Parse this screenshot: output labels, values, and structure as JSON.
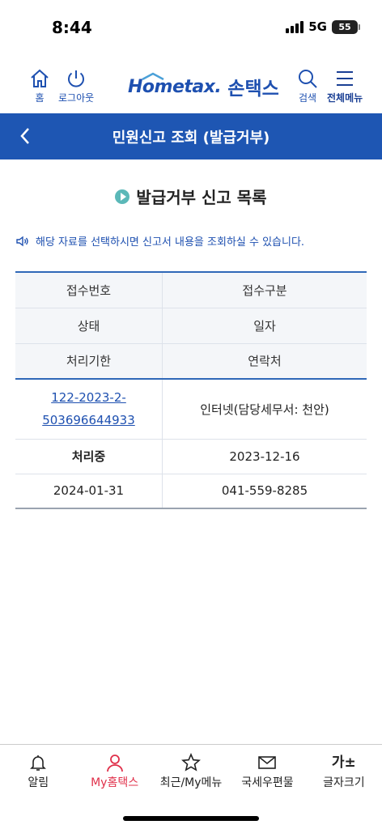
{
  "status_bar": {
    "time": "8:44",
    "network": "5G",
    "battery": "55"
  },
  "header": {
    "home_label": "홈",
    "logout_label": "로그아웃",
    "logo_text": "Hometax.",
    "logo_service": "손택스",
    "search_label": "검색",
    "menu_label": "전체메뉴"
  },
  "title_bar": {
    "title": "민원신고 조회 (발급거부)"
  },
  "section": {
    "title": "발급거부 신고 목록"
  },
  "notice": {
    "text": "해당 자료를 선택하시면 신고서 내용을 조회하실 수 있습니다."
  },
  "table": {
    "headers": [
      [
        "접수번호",
        "접수구분"
      ],
      [
        "상태",
        "일자"
      ],
      [
        "처리기한",
        "연락처"
      ]
    ],
    "record": {
      "receipt_no_line1": "122-2023-2-",
      "receipt_no_line2": "503696644933",
      "receipt_type": "인터넷(담당세무서: 천안)",
      "status": "처리중",
      "date": "2023-12-16",
      "deadline": "2024-01-31",
      "contact": "041-559-8285"
    }
  },
  "bottom_nav": [
    {
      "label": "알림"
    },
    {
      "label": "My홈택스"
    },
    {
      "label": "최근/My메뉴"
    },
    {
      "label": "국세우편물"
    },
    {
      "label": "글자크기",
      "glyph": "가±"
    }
  ],
  "colors": {
    "primary": "#1e56b3",
    "accent_red": "#e12424",
    "nav_active": "#e0304a"
  }
}
